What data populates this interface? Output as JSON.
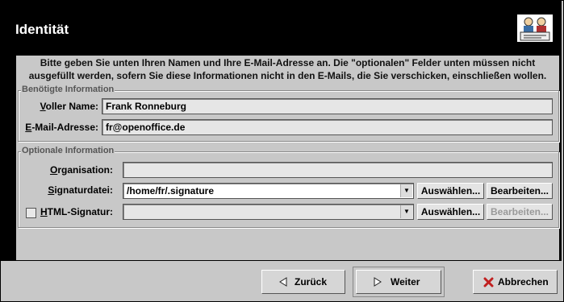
{
  "header": {
    "title": "Identität"
  },
  "intro": {
    "line1": "Bitte geben Sie unten Ihren Namen und Ihre E-Mail-Adresse an. Die \"optionalen\" Felder unten müssen nicht",
    "line2": "ausgefüllt werden, sofern Sie diese Informationen nicht in den E-Mails, die Sie verschicken, einschließen wollen."
  },
  "required": {
    "title": "Benötigte Information",
    "name_label": "Voller Name:",
    "name_value": "Frank Ronneburg",
    "email_label": "E-Mail-Adresse:",
    "email_value": "fr@openoffice.de"
  },
  "optional": {
    "title": "Optionale Information",
    "org_label": "Organisation:",
    "org_value": "",
    "sig_label": "Signaturdatei:",
    "sig_value": "/home/fr/.signature",
    "sig_choose": "Auswählen...",
    "sig_edit": "Bearbeiten...",
    "html_label": "HTML-Signatur:",
    "html_value": "",
    "html_choose": "Auswählen...",
    "html_edit": "Bearbeiten...",
    "html_checked": false
  },
  "footer": {
    "back": "Zurück",
    "next": "Weiter",
    "cancel": "Abbrechen"
  }
}
